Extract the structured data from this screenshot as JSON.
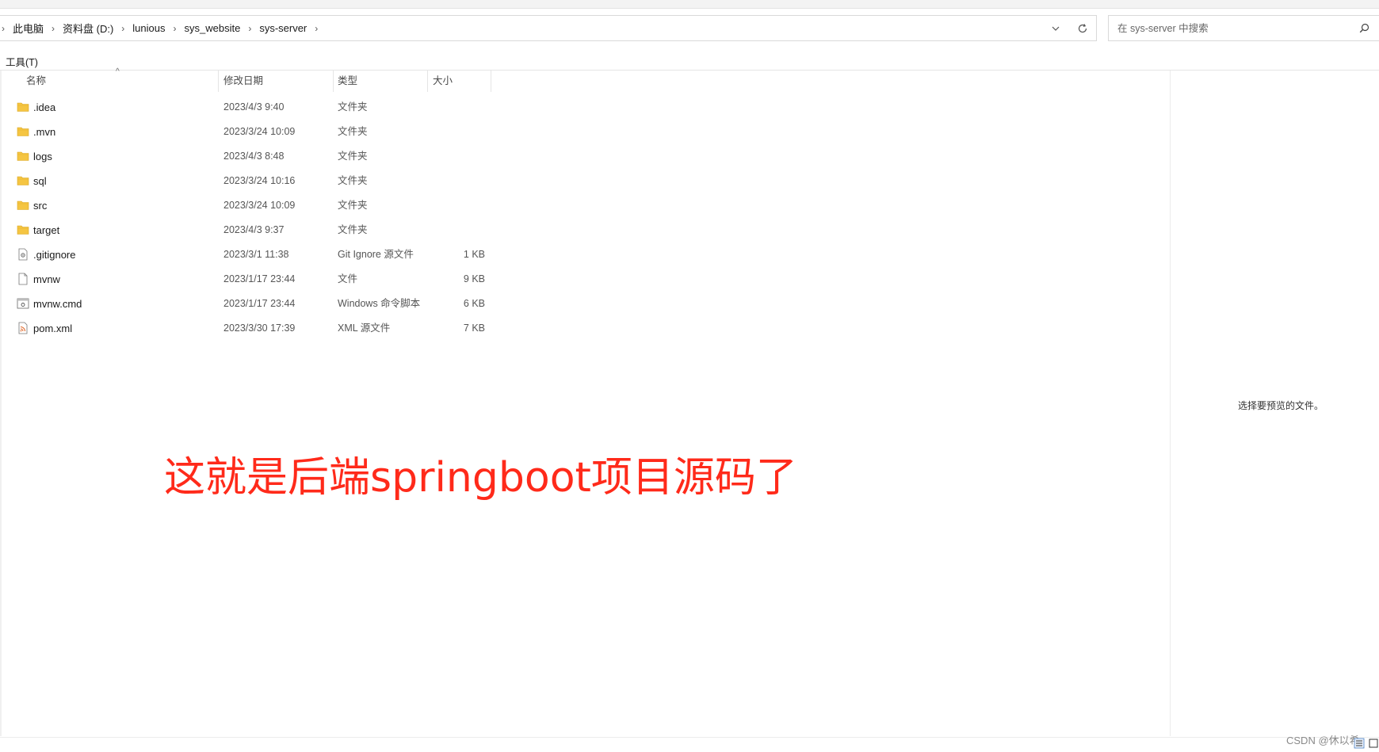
{
  "breadcrumb": {
    "items": [
      "此电脑",
      "资料盘 (D:)",
      "lunious",
      "sys_website",
      "sys-server"
    ]
  },
  "search": {
    "placeholder": "在 sys-server 中搜索"
  },
  "menu": {
    "tools_label": "工具(T)"
  },
  "columns": {
    "name": "名称",
    "date": "修改日期",
    "type": "类型",
    "size": "大小"
  },
  "files": [
    {
      "name": ".idea",
      "date": "2023/4/3 9:40",
      "type": "文件夹",
      "size": "",
      "icon": "folder-icon"
    },
    {
      "name": ".mvn",
      "date": "2023/3/24 10:09",
      "type": "文件夹",
      "size": "",
      "icon": "folder-icon"
    },
    {
      "name": "logs",
      "date": "2023/4/3 8:48",
      "type": "文件夹",
      "size": "",
      "icon": "folder-icon"
    },
    {
      "name": "sql",
      "date": "2023/3/24 10:16",
      "type": "文件夹",
      "size": "",
      "icon": "folder-icon"
    },
    {
      "name": "src",
      "date": "2023/3/24 10:09",
      "type": "文件夹",
      "size": "",
      "icon": "folder-icon"
    },
    {
      "name": "target",
      "date": "2023/4/3 9:37",
      "type": "文件夹",
      "size": "",
      "icon": "folder-icon"
    },
    {
      "name": ".gitignore",
      "date": "2023/3/1 11:38",
      "type": "Git Ignore 源文件",
      "size": "1 KB",
      "icon": "gear-file-icon"
    },
    {
      "name": "mvnw",
      "date": "2023/1/17 23:44",
      "type": "文件",
      "size": "9 KB",
      "icon": "blank-file-icon"
    },
    {
      "name": "mvnw.cmd",
      "date": "2023/1/17 23:44",
      "type": "Windows 命令脚本",
      "size": "6 KB",
      "icon": "script-file-icon"
    },
    {
      "name": "pom.xml",
      "date": "2023/3/30 17:39",
      "type": "XML 源文件",
      "size": "7 KB",
      "icon": "xml-file-icon"
    }
  ],
  "preview": {
    "message": "选择要预览的文件。"
  },
  "annotation": {
    "text": "这就是后端springboot项目源码了"
  },
  "watermark": {
    "text": "CSDN @休以希"
  },
  "colors": {
    "annotation": "#ff2a1a",
    "folder": "#f5c542"
  }
}
